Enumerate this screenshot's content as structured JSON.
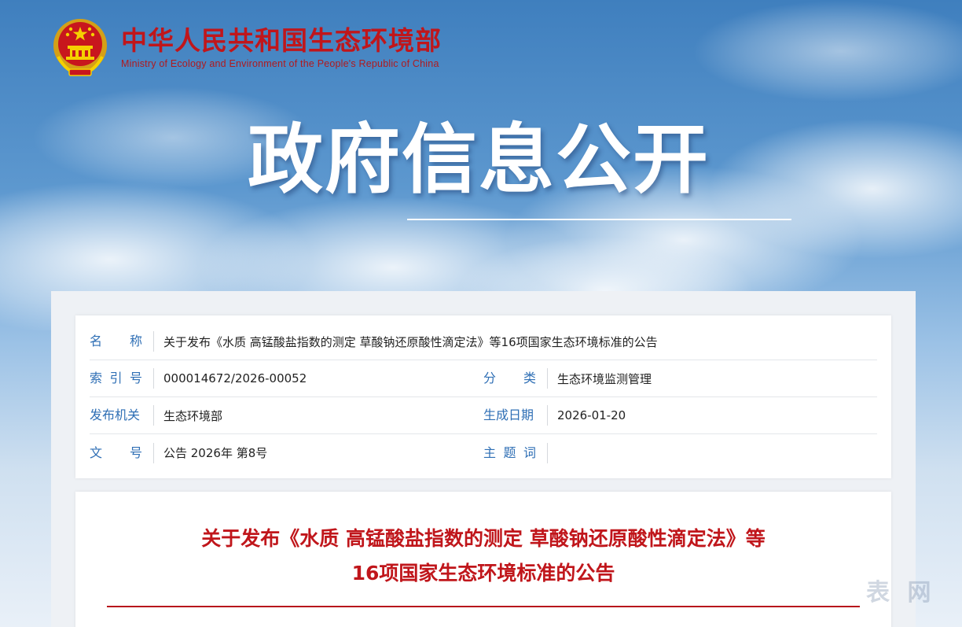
{
  "header": {
    "name_cn": "中华人民共和国生态环境部",
    "name_en": "Ministry of Ecology and Environment of the People's Republic of China"
  },
  "banner": {
    "title": "政府信息公开"
  },
  "meta": {
    "name_label": [
      "名",
      "称"
    ],
    "name_value": "关于发布《水质 高锰酸盐指数的测定 草酸钠还原酸性滴定法》等16项国家生态环境标准的公告",
    "index_label": [
      "索",
      "引",
      "号"
    ],
    "index_value": "000014672/2026-00052",
    "category_label": [
      "分",
      "类"
    ],
    "category_value": "生态环境监测管理",
    "issuer_label": "发布机关",
    "issuer_value": "生态环境部",
    "date_label": "生成日期",
    "date_value": "2026-01-20",
    "doc_label": [
      "文",
      "号"
    ],
    "doc_value": "公告 2026年 第8号",
    "keywords_label": [
      "主",
      "题",
      "词"
    ],
    "keywords_value": ""
  },
  "article": {
    "title_line1": "关于发布《水质 高锰酸盐指数的测定 草酸钠还原酸性滴定法》等",
    "title_line2": "16项国家生态环境标准的公告"
  },
  "watermark": "表 网",
  "colors": {
    "brand_red": "#c0161b",
    "label_blue": "#2f6fb5"
  }
}
